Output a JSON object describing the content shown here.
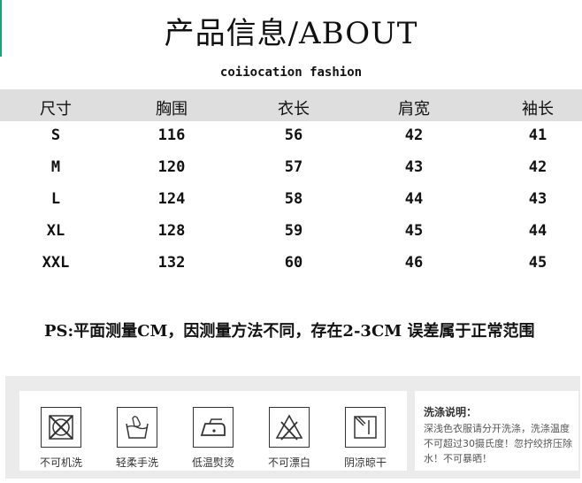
{
  "title": "产品信息/ABOUT",
  "subtitle": "coiiocation fashion",
  "table": {
    "headers": [
      "尺寸",
      "胸围",
      "衣长",
      "肩宽",
      "袖长"
    ],
    "rows": [
      [
        "S",
        "116",
        "56",
        "42",
        "41"
      ],
      [
        "M",
        "120",
        "57",
        "43",
        "42"
      ],
      [
        "L",
        "124",
        "58",
        "44",
        "43"
      ],
      [
        "XL",
        "128",
        "59",
        "45",
        "44"
      ],
      [
        "XXL",
        "132",
        "60",
        "46",
        "45"
      ]
    ]
  },
  "note": "PS:平面测量CM，因测量方法不同，存在2-3CM 误差属于正常范围",
  "care": {
    "items": [
      {
        "label": "不可机洗",
        "icon": "no-machine-wash-icon"
      },
      {
        "label": "轻柔手洗",
        "icon": "hand-wash-icon"
      },
      {
        "label": "低温熨烫",
        "icon": "low-iron-icon"
      },
      {
        "label": "不可漂白",
        "icon": "no-bleach-icon"
      },
      {
        "label": "阴凉晾干",
        "icon": "shade-dry-icon"
      }
    ],
    "title": "洗涤说明：",
    "body": "深浅色衣服请分开洗涤，洗涤温度不可超过30摄氏度！忽拧绞挤压除水！不可暴晒！"
  }
}
